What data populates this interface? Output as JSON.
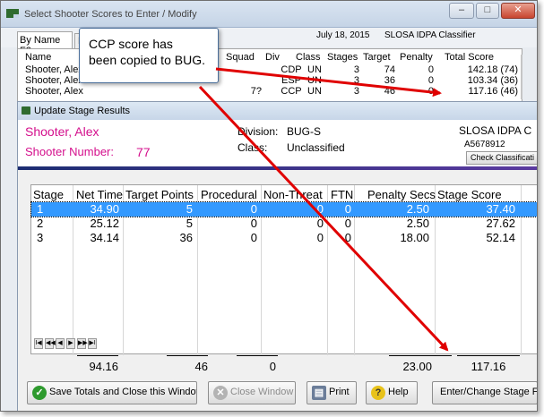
{
  "back_window": {
    "title": "Select Shooter Scores to Enter / Modify",
    "minimize": "–",
    "maximize": "□",
    "close": "✕",
    "tab_by_name": "By Name F2",
    "tab_other": "B",
    "date": "July 18, 2015",
    "match": "SLOSA IDPA  Classifier",
    "headers": {
      "name": "Name",
      "squad": "Squad",
      "div": "Div",
      "class": "Class",
      "stages": "Stages",
      "target": "Target",
      "penalty": "Penalty",
      "total": "Total Score"
    },
    "rows": [
      {
        "name": "Shooter, Alex",
        "div": "CDP",
        "class": "UN",
        "stages": "3",
        "target": "74",
        "penalty": "0",
        "total": "142.18 (74)"
      },
      {
        "name": "Shooter, Alex",
        "div": "ESP",
        "class": "UN",
        "stages": "3",
        "target": "36",
        "penalty": "0",
        "total": "103.34 (36)"
      },
      {
        "name": "Shooter, Alex",
        "squad": "7?",
        "div": "CCP",
        "class": "UN",
        "stages": "3",
        "target": "46",
        "penalty": "0",
        "total": "117.16 (46)"
      }
    ]
  },
  "front_window": {
    "title": "Update Stage Results",
    "shooter_name": "Shooter, Alex",
    "shooter_number_label": "Shooter Number:",
    "shooter_number": "77",
    "division_label": "Division:",
    "division_value": "BUG-S",
    "class_label": "Class:",
    "class_value": "Unclassified",
    "match_name": "SLOSA IDPA  C",
    "member_id": "A5678912",
    "check_class_button": "Check Classificati",
    "grid_headers": {
      "stage": "Stage",
      "net_time": "Net Time",
      "target_points": "Target Points",
      "procedural": "Procedural",
      "non_threat": "Non-Threat",
      "ftn": "FTN",
      "penalty_secs": "Penalty Secs",
      "stage_score": "Stage Score"
    },
    "stages": [
      {
        "stage": "1",
        "net_time": "34.90",
        "target_points": "5",
        "procedural": "0",
        "non_threat": "0",
        "ftn": "0",
        "penalty_secs": "2.50",
        "stage_score": "37.40"
      },
      {
        "stage": "2",
        "net_time": "25.12",
        "target_points": "5",
        "procedural": "0",
        "non_threat": "0",
        "ftn": "0",
        "penalty_secs": "2.50",
        "stage_score": "27.62"
      },
      {
        "stage": "3",
        "net_time": "34.14",
        "target_points": "36",
        "procedural": "0",
        "non_threat": "0",
        "ftn": "0",
        "penalty_secs": "18.00",
        "stage_score": "52.14"
      }
    ],
    "nav": [
      "I◀",
      "◀◀",
      "◀",
      "▶",
      "▶▶",
      "▶I"
    ],
    "totals": {
      "net_time": "94.16",
      "target_points": "46",
      "procedural": "0",
      "penalty_secs": "23.00",
      "stage_score": "117.16"
    },
    "buttons": {
      "save": "Save Totals and Close this Window",
      "close": "Close Window",
      "print": "Print",
      "help": "Help",
      "enter": "Enter/Change Stage F"
    }
  },
  "callout": {
    "line1": "CCP score has",
    "line2": "been copied to BUG."
  },
  "colors": {
    "shooter_accent": "#d40f8c",
    "selection": "#3399ff",
    "arrow": "#e00000"
  }
}
